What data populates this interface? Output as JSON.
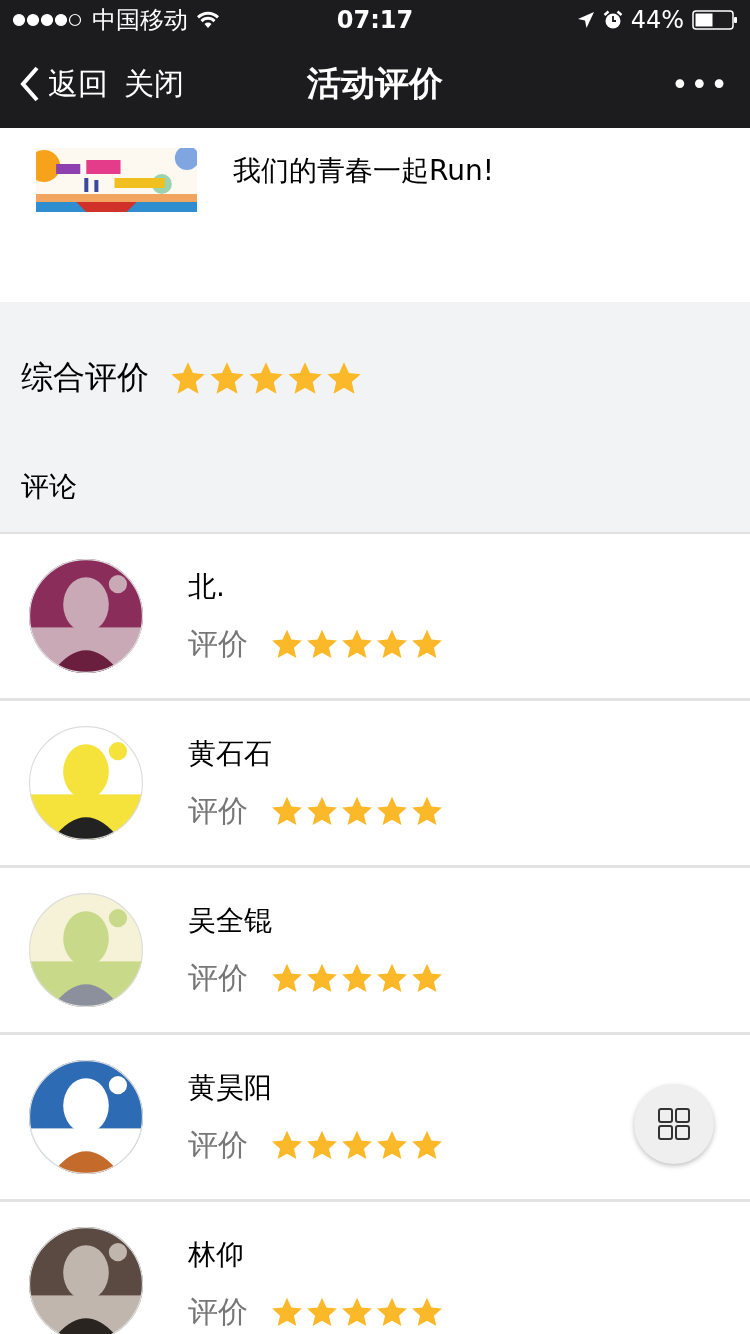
{
  "status_bar": {
    "carrier": "中国移动",
    "time": "07:17",
    "battery": "44%"
  },
  "nav": {
    "back": "返回",
    "close": "关闭",
    "title": "活动评价",
    "more": "•••"
  },
  "activity": {
    "title": "我们的青春一起Run!"
  },
  "overall": {
    "label": "综合评价",
    "stars": 5
  },
  "comments_heading": "评论",
  "comments": [
    {
      "name": "北.",
      "label": "评价",
      "stars": 5
    },
    {
      "name": "黄石石",
      "label": "评价",
      "stars": 5
    },
    {
      "name": "吴全锟",
      "label": "评价",
      "stars": 5
    },
    {
      "name": "黄昊阳",
      "label": "评价",
      "stars": 5
    },
    {
      "name": "林仰",
      "label": "评价",
      "stars": 5
    }
  ]
}
